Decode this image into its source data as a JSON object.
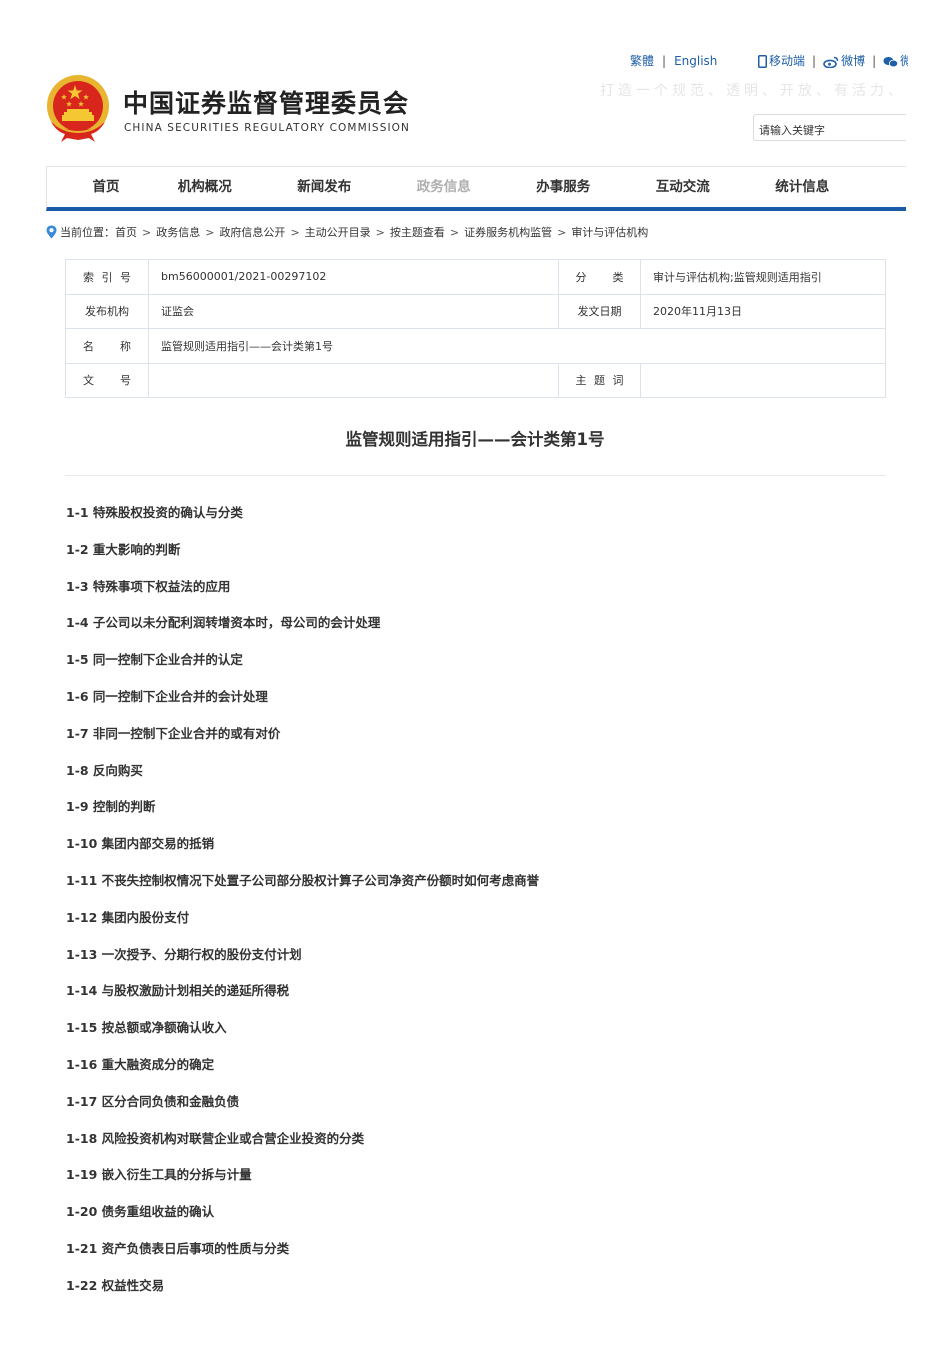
{
  "header": {
    "title": "中国证券监督管理委员会",
    "subtitle": "CHINA SECURITIES REGULATORY COMMISSION",
    "lang_links": [
      "繁體",
      "English"
    ],
    "social_links": [
      {
        "icon": "mobile-icon",
        "label": "移动端"
      },
      {
        "icon": "weibo-icon",
        "label": "微博"
      },
      {
        "icon": "wechat-icon",
        "label": "微"
      }
    ],
    "slogan": "打造一个规范、透明、开放、有活力、有韧性的资本市场",
    "search_placeholder": "请输入关键字"
  },
  "nav": {
    "items": [
      "首页",
      "机构概况",
      "新闻发布",
      "政务信息",
      "办事服务",
      "互动交流",
      "统计信息"
    ],
    "active_index": 3,
    "accent_color": "#1a5aa6"
  },
  "breadcrumb": {
    "prefix": "当前位置：",
    "items": [
      "首页",
      "政务信息",
      "政府信息公开",
      "主动公开目录",
      "按主题查看",
      "证券服务机构监管",
      "审计与评估机构"
    ]
  },
  "info": {
    "index_label": [
      "索",
      "引",
      "号"
    ],
    "index_value": "bm56000001/2021-00297102",
    "category_label": [
      "分",
      "类"
    ],
    "category_value": "审计与评估机构;监管规则适用指引",
    "publisher_label": "发布机构",
    "publisher_value": "证监会",
    "date_label": "发文日期",
    "date_value": "2020年11月13日",
    "name_label": [
      "名",
      "称"
    ],
    "name_value": "监管规则适用指引——会计类第1号",
    "docno_label": [
      "文",
      "号"
    ],
    "docno_value": "",
    "keywords_label": [
      "主",
      "题",
      "词"
    ],
    "keywords_value": ""
  },
  "document": {
    "title": "监管规则适用指引——会计类第1号",
    "items": [
      "1-1 特殊股权投资的确认与分类",
      "1-2 重大影响的判断",
      "1-3 特殊事项下权益法的应用",
      "1-4 子公司以未分配利润转增资本时，母公司的会计处理",
      "1-5 同一控制下企业合并的认定",
      "1-6 同一控制下企业合并的会计处理",
      "1-7 非同一控制下企业合并的或有对价",
      "1-8 反向购买",
      "1-9 控制的判断",
      "1-10 集团内部交易的抵销",
      "1-11 不丧失控制权情况下处置子公司部分股权计算子公司净资产份额时如何考虑商誉",
      "1-12 集团内股份支付",
      "1-13 一次授予、分期行权的股份支付计划",
      "1-14 与股权激励计划相关的递延所得税",
      "1-15 按总额或净额确认收入",
      "1-16 重大融资成分的确定",
      "1-17 区分合同负债和金融负债",
      "1-18 风险投资机构对联营企业或合营企业投资的分类",
      "1-19 嵌入衍生工具的分拆与计量",
      "1-20 债务重组收益的确认",
      "1-21 资产负债表日后事项的性质与分类",
      "1-22 权益性交易"
    ]
  }
}
